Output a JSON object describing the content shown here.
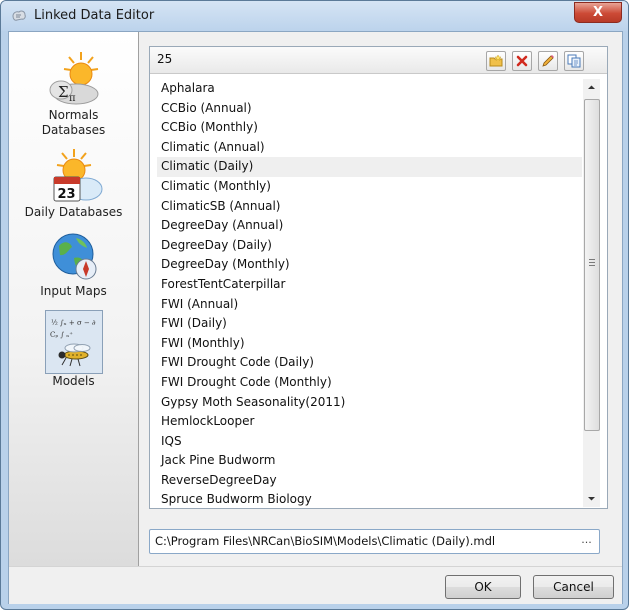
{
  "window": {
    "title": "Linked Data Editor",
    "close_label": "X"
  },
  "sidebar": {
    "items": [
      {
        "label_line1": "Normals",
        "label_line2": "Databases",
        "icon": "normals-sun-sigma-icon"
      },
      {
        "label": "Daily Databases",
        "calendar_day": "23",
        "icon": "daily-calendar-sun-icon"
      },
      {
        "label": "Input Maps",
        "icon": "globe-compass-icon"
      },
      {
        "label": "Models",
        "icon": "insect-formula-icon"
      }
    ]
  },
  "list_panel": {
    "count": "25",
    "toolbar_icons": [
      "new-folder-icon",
      "delete-icon",
      "edit-pencil-icon",
      "copy-icon"
    ],
    "items": [
      "Aphalara",
      "CCBio (Annual)",
      "CCBio (Monthly)",
      "Climatic (Annual)",
      "Climatic (Daily)",
      "Climatic (Monthly)",
      "ClimaticSB (Annual)",
      "DegreeDay (Annual)",
      "DegreeDay (Daily)",
      "DegreeDay (Monthly)",
      "ForestTentCaterpillar",
      "FWI (Annual)",
      "FWI (Daily)",
      "FWI (Monthly)",
      "FWI Drought Code (Daily)",
      "FWI Drought Code (Monthly)",
      "Gypsy Moth Seasonality(2011)",
      "HemlockLooper",
      "IQS",
      "Jack Pine Budworm",
      "ReverseDegreeDay",
      "Spruce Budworm Biology"
    ],
    "selected": "Climatic (Daily)"
  },
  "path": {
    "value": "C:\\Program Files\\NRCan\\BioSIM\\Models\\Climatic (Daily).mdl",
    "browse_label": "..."
  },
  "buttons": {
    "ok": "OK",
    "cancel": "Cancel"
  },
  "colors": {
    "title_bar": "#c4d8ee",
    "close_button": "#c9493a",
    "selection": "#efefef"
  }
}
